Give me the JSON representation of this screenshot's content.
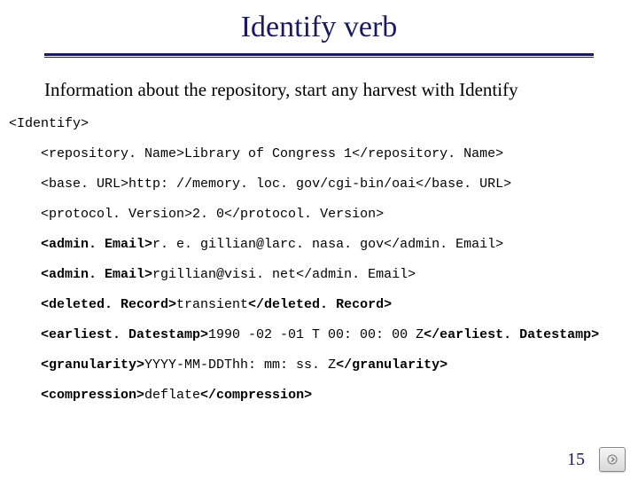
{
  "title": "Identify verb",
  "subtitle": "Information about the repository, start any harvest with Identify",
  "code": {
    "open_tag": "<Identify>",
    "lines": [
      {
        "tag_open": "<repository. Name>",
        "value": "Library of Congress 1",
        "tag_close": "</repository. Name>",
        "bold_tag": false
      },
      {
        "tag_open": "<base. URL>",
        "value": "http: //memory. loc. gov/cgi-bin/oai",
        "tag_close": "</base. URL>",
        "bold_tag": false
      },
      {
        "tag_open": "<protocol. Version>",
        "value": "2. 0",
        "tag_close": "</protocol. Version>",
        "bold_tag": false
      },
      {
        "tag_open": "<admin. Email>",
        "value": "r. e. gillian@larc. nasa. gov",
        "tag_close": "</admin. Email>",
        "bold_tag": true
      },
      {
        "tag_open": "<admin. Email>",
        "value": "rgillian@visi. net",
        "tag_close": "</admin. Email>",
        "bold_tag": true
      },
      {
        "tag_open": "<deleted. Record>",
        "value": "transient",
        "tag_close": "</deleted. Record>",
        "bold_tag": true
      },
      {
        "tag_open": "<earliest. Datestamp>",
        "value": "1990 -02 -01 T 00: 00: 00 Z",
        "tag_close": "</earliest. Datestamp>",
        "bold_tag": true
      },
      {
        "tag_open": "<granularity>",
        "value": "YYYY-MM-DDThh: mm: ss. Z",
        "tag_close": "</granularity>",
        "bold_tag": true
      },
      {
        "tag_open": "<compression>",
        "value": "deflate",
        "tag_close": "</compression>",
        "bold_tag": true
      }
    ]
  },
  "page_number": "15",
  "icons": {
    "nav_next": "nav-next"
  }
}
